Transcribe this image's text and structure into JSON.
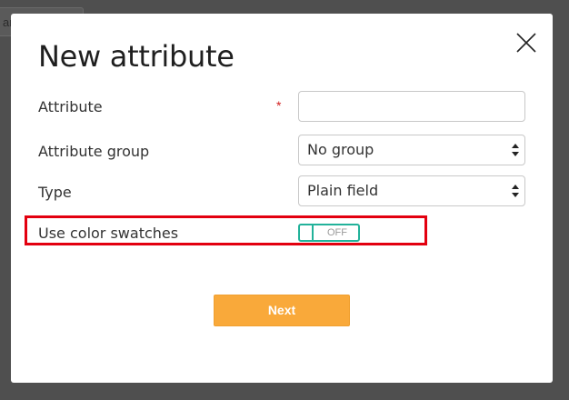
{
  "background": {
    "tab_label": "an"
  },
  "dialog": {
    "title": "New attribute",
    "close_icon": "close-icon"
  },
  "form": {
    "attribute": {
      "label": "Attribute",
      "required_marker": "*",
      "value": "",
      "placeholder": ""
    },
    "attribute_group": {
      "label": "Attribute group",
      "selected": "No group"
    },
    "type": {
      "label": "Type",
      "selected": "Plain field"
    },
    "color_swatches": {
      "label": "Use color swatches",
      "toggle_state": "OFF"
    }
  },
  "actions": {
    "next_label": "Next"
  },
  "colors": {
    "accent_toggle": "#22b29a",
    "button_orange": "#f9a93a",
    "highlight_red": "#e3000f",
    "required_red": "#d21f1f"
  }
}
